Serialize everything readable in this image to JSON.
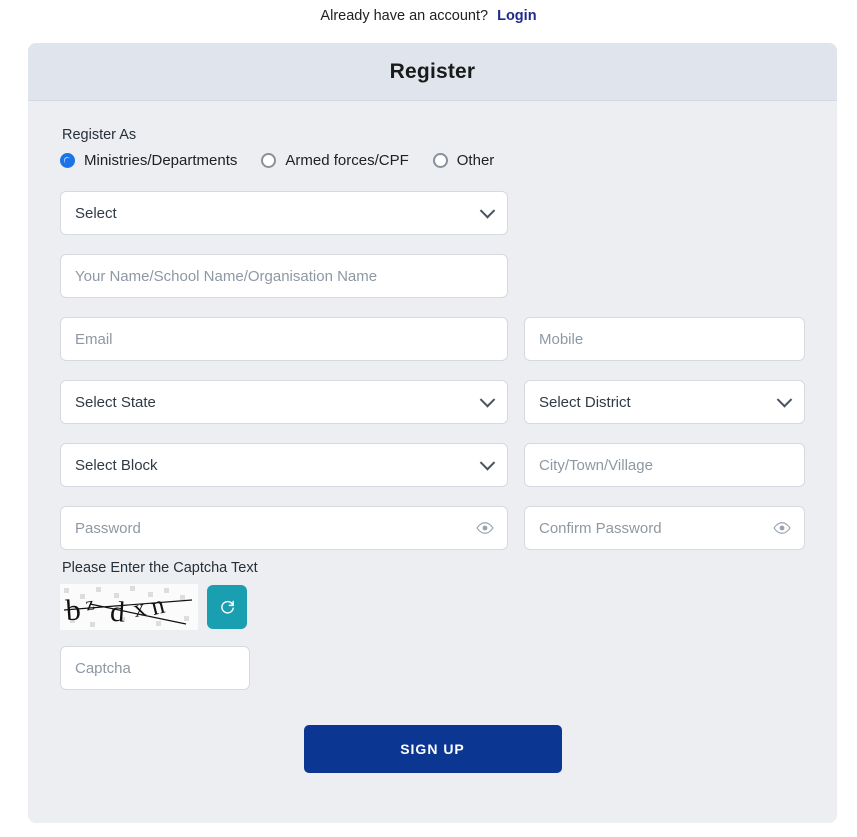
{
  "top": {
    "prompt": "Already have an account?",
    "login_label": "Login"
  },
  "card": {
    "title": "Register"
  },
  "register_as": {
    "label": "Register As",
    "options": [
      {
        "label": "Ministries/Departments",
        "selected": true
      },
      {
        "label": "Armed forces/CPF",
        "selected": false
      },
      {
        "label": "Other",
        "selected": false
      }
    ]
  },
  "fields": {
    "category_select": {
      "value": "Select"
    },
    "name": {
      "placeholder": "Your Name/School Name/Organisation Name",
      "value": ""
    },
    "email": {
      "placeholder": "Email",
      "value": ""
    },
    "mobile": {
      "placeholder": "Mobile",
      "value": ""
    },
    "state_select": {
      "value": "Select State"
    },
    "district_select": {
      "value": "Select District"
    },
    "block_select": {
      "value": "Select Block"
    },
    "city": {
      "placeholder": "City/Town/Village",
      "value": ""
    },
    "password": {
      "placeholder": "Password",
      "value": ""
    },
    "confirm_password": {
      "placeholder": "Confirm Password",
      "value": ""
    }
  },
  "captcha": {
    "label": "Please Enter the Captcha Text",
    "text": "bzdxn",
    "refresh_icon": "refresh-icon",
    "input_placeholder": "Captcha"
  },
  "actions": {
    "signup_label": "SIGN UP"
  },
  "colors": {
    "accent_blue": "#1a73e8",
    "link_navy": "#1f2a8c",
    "signup_blue": "#0b3793",
    "refresh_teal": "#1a9fb0",
    "card_body": "#eceef1",
    "card_header": "#e0e4ec"
  }
}
